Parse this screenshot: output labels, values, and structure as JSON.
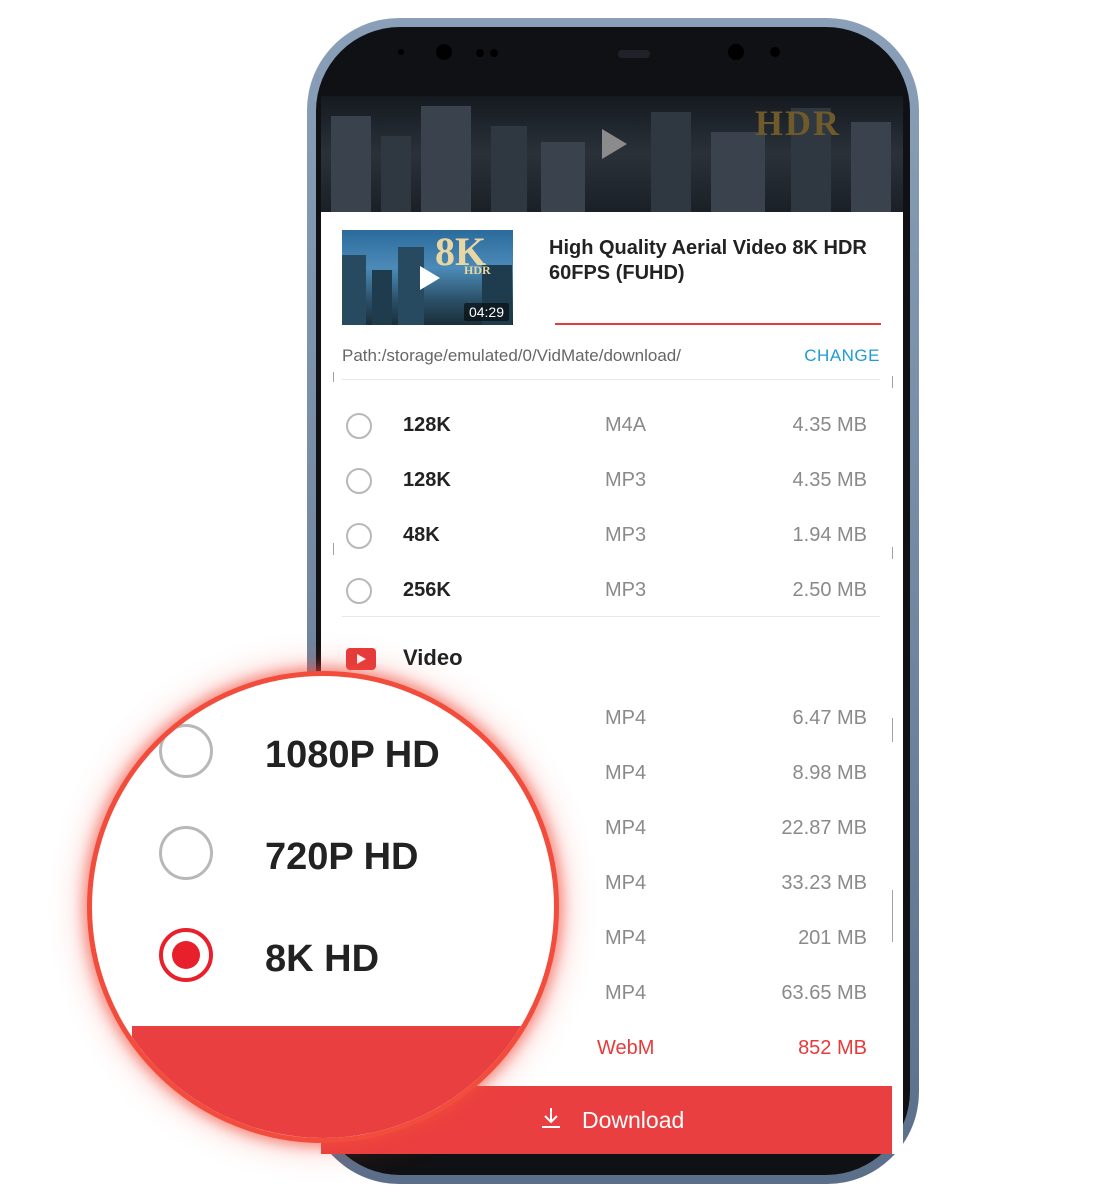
{
  "video": {
    "title": "High Quality Aerial Video 8K HDR 60FPS (FUHD)",
    "duration": "04:29",
    "preview_overlay": "HDR",
    "thumb_badge_main": "8K",
    "thumb_badge_sub": "HDR"
  },
  "path": {
    "text": "Path:/storage/emulated/0/VidMate/download/",
    "change_label": "CHANGE"
  },
  "audio_options": [
    {
      "quality": "128K",
      "format": "M4A",
      "size": "4.35 MB"
    },
    {
      "quality": "128K",
      "format": "MP3",
      "size": "4.35 MB"
    },
    {
      "quality": "48K",
      "format": "MP3",
      "size": "1.94 MB"
    },
    {
      "quality": "256K",
      "format": "MP3",
      "size": "2.50 MB"
    }
  ],
  "video_section": {
    "label": "Video"
  },
  "video_options": [
    {
      "format": "MP4",
      "size": "6.47 MB"
    },
    {
      "format": "MP4",
      "size": "8.98 MB"
    },
    {
      "format": "MP4",
      "size": "22.87 MB"
    },
    {
      "format": "MP4",
      "size": "33.23 MB"
    },
    {
      "format": "MP4",
      "size": "201 MB"
    },
    {
      "format": "MP4",
      "size": "63.65 MB"
    },
    {
      "format": "WebM",
      "size": "852 MB"
    }
  ],
  "zoom_options": [
    {
      "quality": "1080P HD",
      "selected": false
    },
    {
      "quality": "720P HD",
      "selected": false
    },
    {
      "quality": "8K HD",
      "selected": true
    }
  ],
  "download": {
    "label": "Download"
  },
  "colors": {
    "accent": "#ea3f41",
    "link": "#1e9bd7",
    "lens_border": "#f24c3c"
  }
}
